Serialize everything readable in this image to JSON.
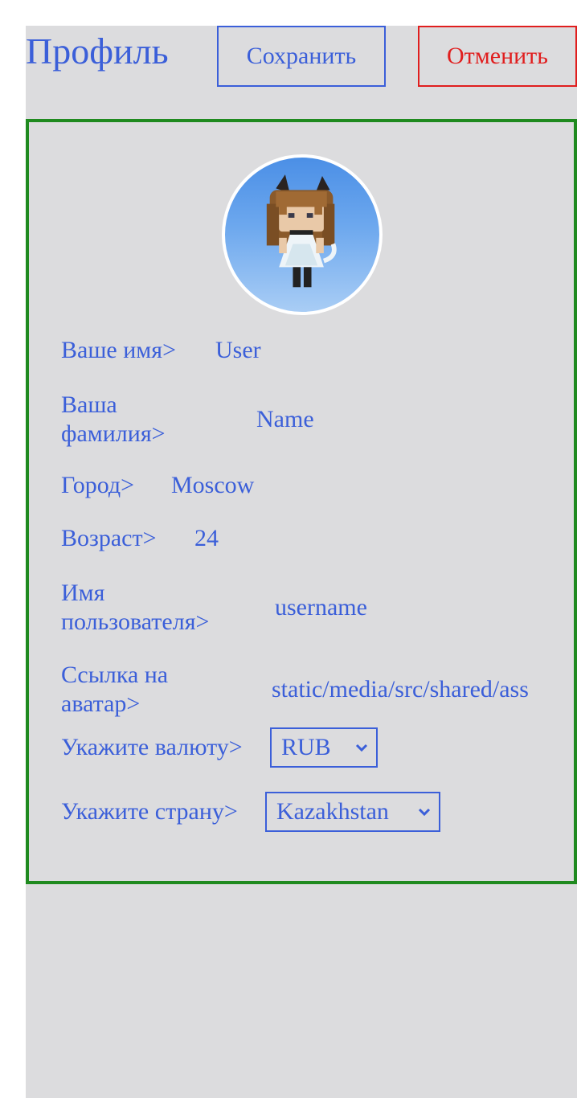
{
  "header": {
    "title": "Профиль",
    "save_label": "Сохранить",
    "cancel_label": "Отменить"
  },
  "profile": {
    "fields": [
      {
        "label": "Ваше имя>",
        "value": "User"
      },
      {
        "label_lines": [
          "Ваша",
          "фамилия>"
        ],
        "value": "Name"
      },
      {
        "label": "Город>",
        "value": "Moscow"
      },
      {
        "label": "Возраст>",
        "value": "24"
      },
      {
        "label_lines": [
          "Имя",
          "пользователя>"
        ],
        "value": "username"
      },
      {
        "label_lines": [
          "Ссылка на",
          "аватар>"
        ],
        "value": "static/media/src/shared/ass"
      }
    ],
    "currency": {
      "label": "Укажите валюту>",
      "selected": "RUB"
    },
    "country": {
      "label": "Укажите страну>",
      "selected": "Kazakhstan"
    }
  },
  "colors": {
    "accent": "#3b5fd9",
    "danger": "#e01e1e",
    "card_border": "#1f8a1f",
    "background": "#dcdcde"
  },
  "icons": {
    "select_arrow": "chevron-down-icon",
    "avatar": "avatar-image"
  }
}
